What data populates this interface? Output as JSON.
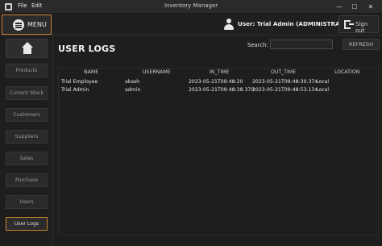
{
  "window": {
    "menu_file": "File",
    "menu_edit": "Edit",
    "title": "Inventory Manager",
    "minimize": "—",
    "maximize": "☐",
    "close": "✕"
  },
  "header": {
    "menu_label": "MENU",
    "user_label": "User: Trial Admin (ADMINISTRATOR)",
    "signout_label": "Sign out"
  },
  "sidebar": {
    "items": [
      "Products",
      "Current Stock",
      "Customers",
      "Suppliers",
      "Sales",
      "Purchase",
      "Users",
      "User Logs"
    ],
    "active": "User Logs"
  },
  "main": {
    "title": "USER LOGS",
    "search_label": "Search:",
    "search_value": "",
    "refresh_label": "REFRESH"
  },
  "table": {
    "columns": [
      "NAME",
      "USERNAME",
      "IN_TIME",
      "OUT_TIME",
      "LOCATION"
    ],
    "rows": [
      [
        "Trial Employee",
        "akash",
        "2023-05-21T09:48:20",
        "2023-05-21T09:48:30.374",
        "Local"
      ],
      [
        "Trial Admin",
        "admin",
        "2023-05-21T09:48:38.370",
        "2023-05-21T09:48:53.134",
        "Local"
      ]
    ]
  },
  "colors": {
    "accent": "#c9832e",
    "background": "#1e1e1e"
  }
}
